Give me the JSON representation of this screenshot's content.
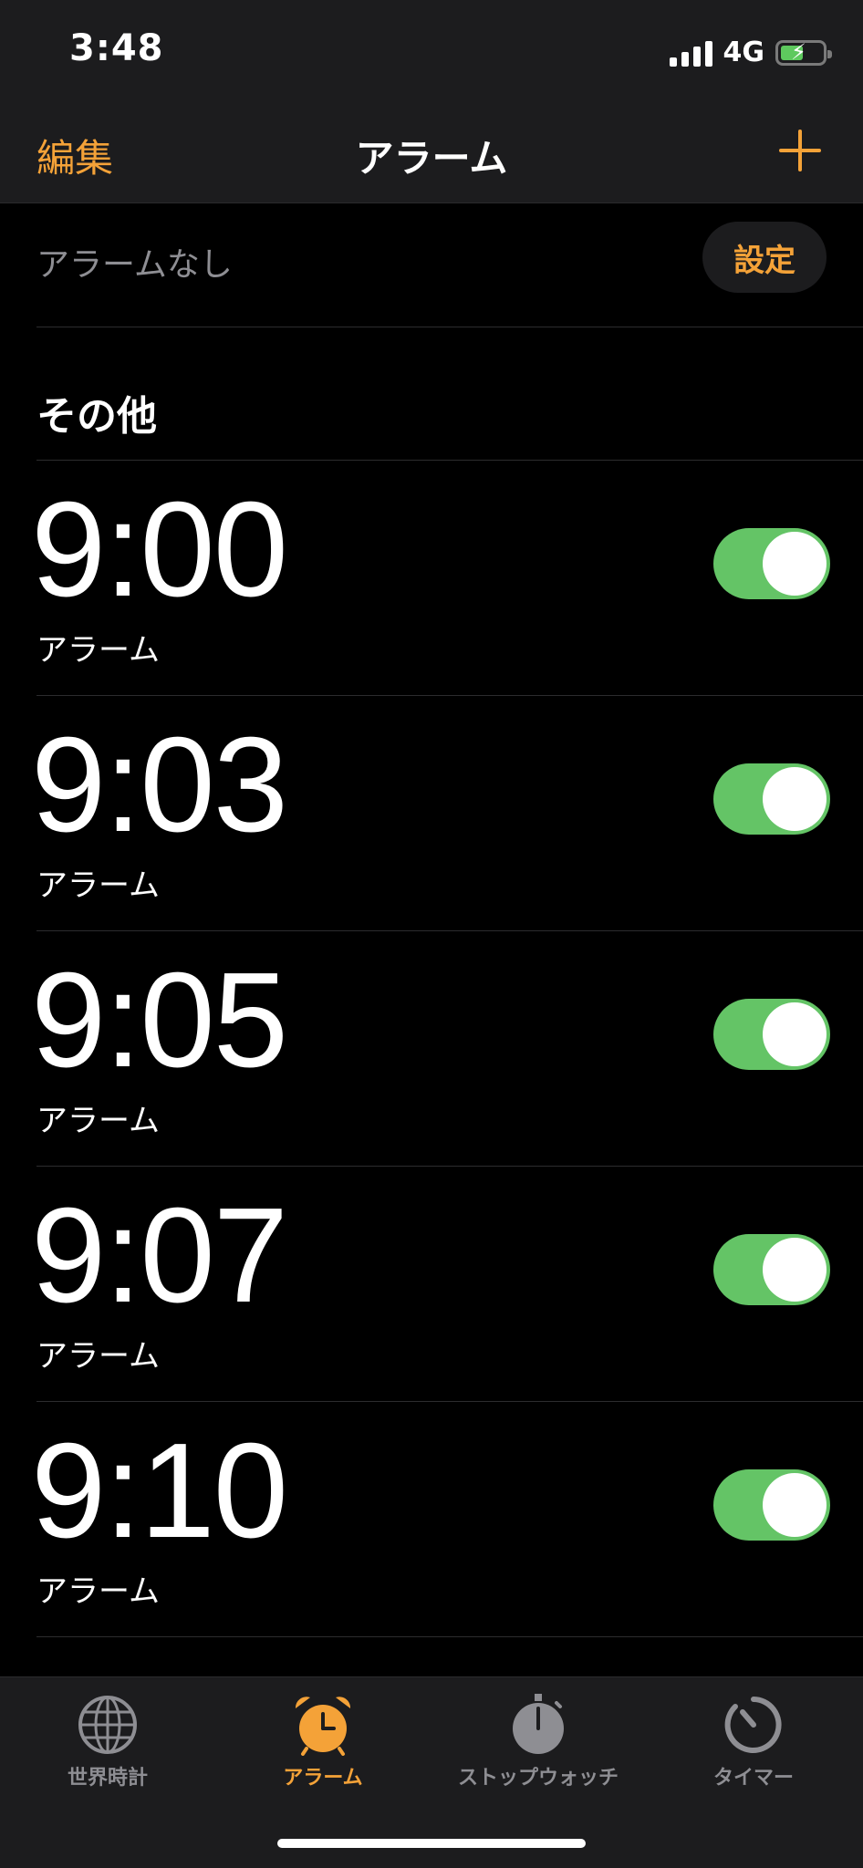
{
  "status": {
    "time": "3:48",
    "network": "4G"
  },
  "nav": {
    "edit_label": "編集",
    "title": "アラーム"
  },
  "sleep": {
    "label": "アラームなし",
    "button_label": "設定"
  },
  "section": {
    "title": "その他"
  },
  "alarms": [
    {
      "time": "9:00",
      "label": "アラーム",
      "enabled": true
    },
    {
      "time": "9:03",
      "label": "アラーム",
      "enabled": true
    },
    {
      "time": "9:05",
      "label": "アラーム",
      "enabled": true
    },
    {
      "time": "9:07",
      "label": "アラーム",
      "enabled": true
    },
    {
      "time": "9:10",
      "label": "アラーム",
      "enabled": true
    }
  ],
  "tabs": [
    {
      "label": "世界時計",
      "icon": "globe-icon",
      "active": false
    },
    {
      "label": "アラーム",
      "icon": "alarm-clock-icon",
      "active": true
    },
    {
      "label": "ストップウォッチ",
      "icon": "stopwatch-icon",
      "active": false
    },
    {
      "label": "タイマー",
      "icon": "timer-icon",
      "active": false
    }
  ],
  "colors": {
    "accent": "#f4a238",
    "toggle_on": "#64c466",
    "secondary_text": "#8e8e93"
  }
}
